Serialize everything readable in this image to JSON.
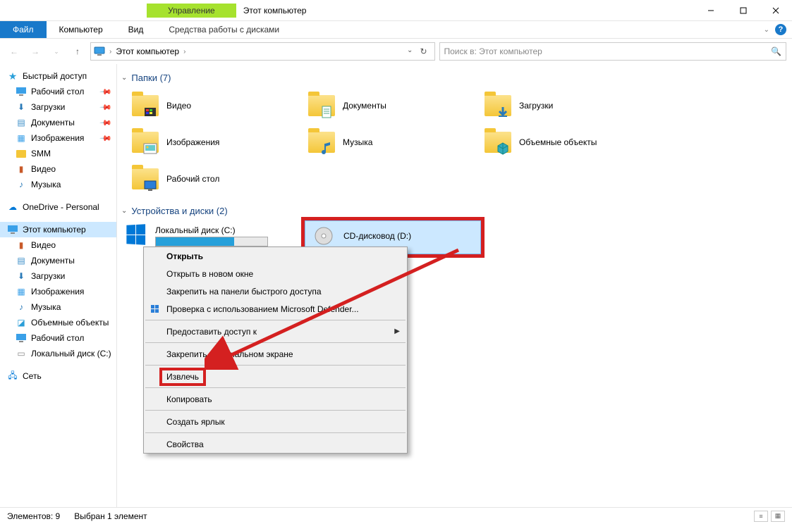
{
  "titlebar": {
    "manage": "Управление",
    "title": "Этот компьютер"
  },
  "ribbon": {
    "file": "Файл",
    "computer": "Компьютер",
    "view": "Вид",
    "drive_tools": "Средства работы с дисками"
  },
  "address": {
    "crumb": "Этот компьютер"
  },
  "search": {
    "placeholder": "Поиск в: Этот компьютер"
  },
  "sidebar": {
    "quick": "Быстрый доступ",
    "quick_items": [
      {
        "label": "Рабочий стол",
        "icon": "desktop",
        "pinned": true
      },
      {
        "label": "Загрузки",
        "icon": "downloads",
        "pinned": true
      },
      {
        "label": "Документы",
        "icon": "documents",
        "pinned": true
      },
      {
        "label": "Изображения",
        "icon": "pictures",
        "pinned": true
      },
      {
        "label": "SMM",
        "icon": "folder",
        "pinned": false
      },
      {
        "label": "Видео",
        "icon": "video",
        "pinned": false
      },
      {
        "label": "Музыка",
        "icon": "music",
        "pinned": false
      }
    ],
    "onedrive": "OneDrive - Personal",
    "thispc": "Этот компьютер",
    "thispc_items": [
      {
        "label": "Видео",
        "icon": "video"
      },
      {
        "label": "Документы",
        "icon": "documents"
      },
      {
        "label": "Загрузки",
        "icon": "downloads"
      },
      {
        "label": "Изображения",
        "icon": "pictures"
      },
      {
        "label": "Музыка",
        "icon": "music"
      },
      {
        "label": "Объемные объекты",
        "icon": "objects3d"
      },
      {
        "label": "Рабочий стол",
        "icon": "desktop"
      },
      {
        "label": "Локальный диск (C:)",
        "icon": "drive"
      }
    ],
    "network": "Сеть"
  },
  "sections": {
    "folders": "Папки (7)",
    "drives": "Устройства и диски (2)"
  },
  "folders": [
    {
      "label": "Видео",
      "overlay": "video"
    },
    {
      "label": "Документы",
      "overlay": "documents"
    },
    {
      "label": "Загрузки",
      "overlay": "downloads"
    },
    {
      "label": "Изображения",
      "overlay": "pictures"
    },
    {
      "label": "Музыка",
      "overlay": "music"
    },
    {
      "label": "Объемные объекты",
      "overlay": "objects3d"
    },
    {
      "label": "Рабочий стол",
      "overlay": "desktop"
    }
  ],
  "drives": [
    {
      "label": "Локальный диск (C:)",
      "fill_pct": 70,
      "selected": false
    },
    {
      "label": "CD-дисковод (D:)",
      "selected": true
    }
  ],
  "context_menu": [
    {
      "label": "Открыть",
      "bold": true
    },
    {
      "label": "Открыть в новом окне"
    },
    {
      "label": "Закрепить на панели быстрого доступа"
    },
    {
      "label": "Проверка с использованием Microsoft Defender...",
      "icon": "shield"
    },
    {
      "sep": true
    },
    {
      "label": "Предоставить доступ к",
      "submenu": true
    },
    {
      "sep": true
    },
    {
      "label": "Закрепить на начальном экране"
    },
    {
      "sep": true
    },
    {
      "label": "Извлечь",
      "emph": true
    },
    {
      "sep": true
    },
    {
      "label": "Копировать"
    },
    {
      "sep": true
    },
    {
      "label": "Создать ярлык"
    },
    {
      "sep": true
    },
    {
      "label": "Свойства"
    }
  ],
  "statusbar": {
    "count": "Элементов: 9",
    "selected": "Выбран 1 элемент"
  }
}
